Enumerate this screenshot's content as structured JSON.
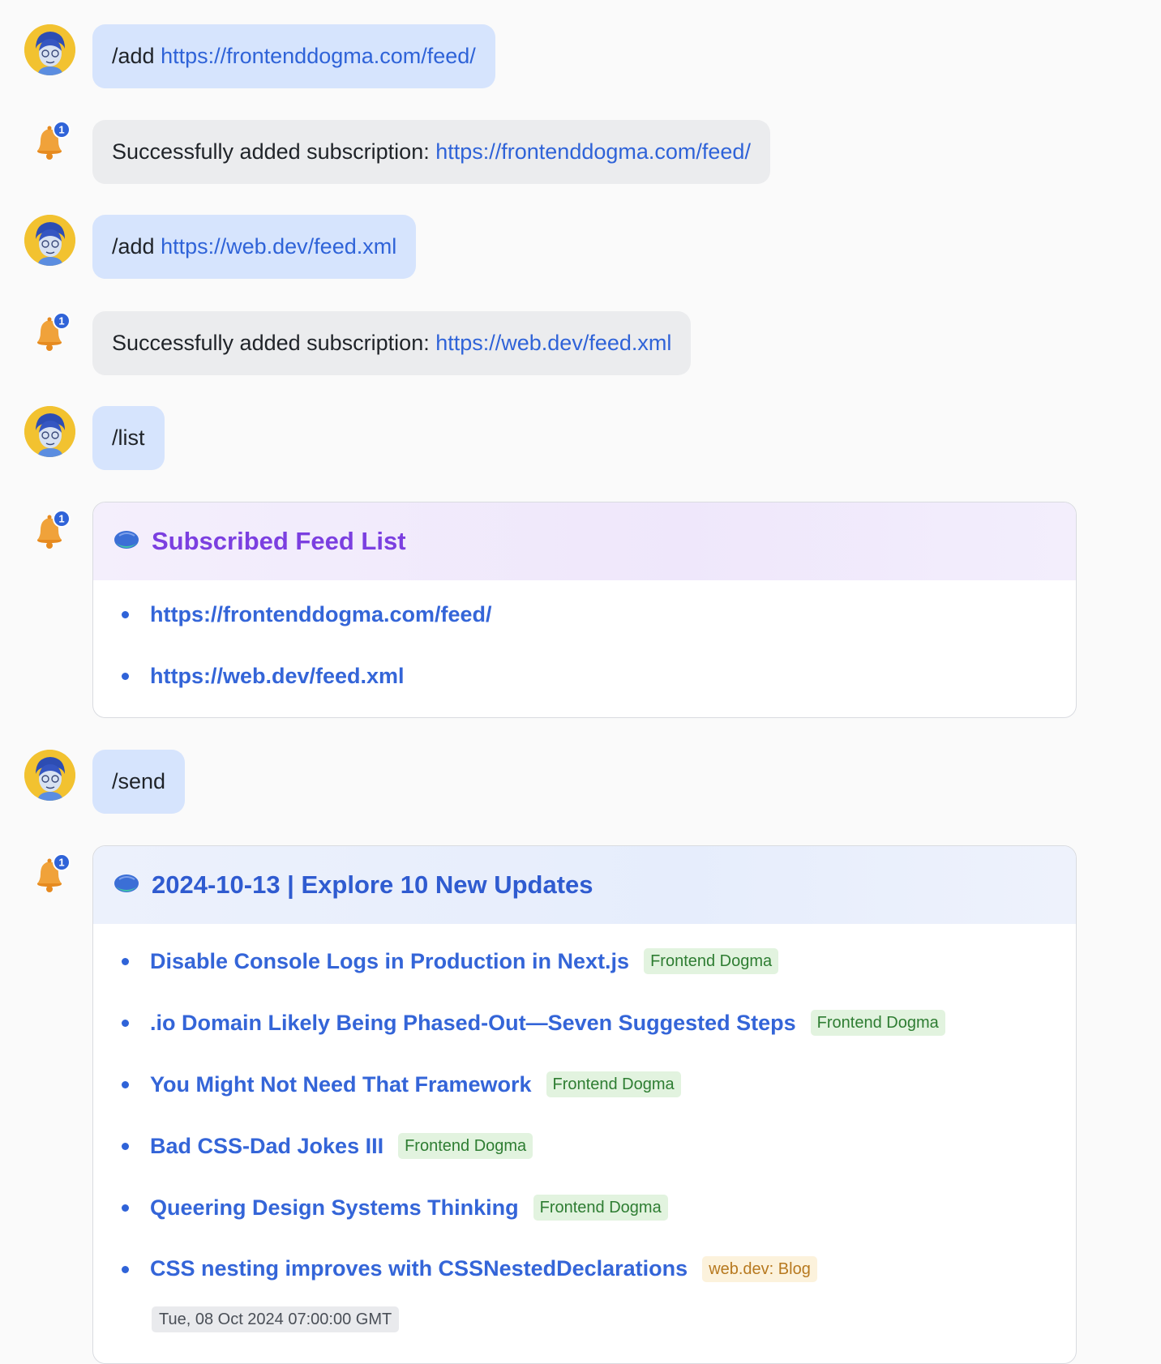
{
  "messages": [
    {
      "role": "user",
      "command": "/add",
      "link": "https://frontenddogma.com/feed/"
    },
    {
      "role": "bot",
      "text": "Successfully added subscription: ",
      "link": "https://frontenddogma.com/feed/"
    },
    {
      "role": "user",
      "command": "/add",
      "link": "https://web.dev/feed.xml"
    },
    {
      "role": "bot",
      "text": "Successfully added subscription: ",
      "link": "https://web.dev/feed.xml"
    },
    {
      "role": "user",
      "command": "/list"
    },
    {
      "role": "user",
      "command": "/send"
    }
  ],
  "feed_list_card": {
    "title": "Subscribed Feed List",
    "items": [
      "https://frontenddogma.com/feed/",
      "https://web.dev/feed.xml"
    ]
  },
  "updates_card": {
    "title": "2024-10-13 | Explore 10 New Updates",
    "items": [
      {
        "title": "Disable Console Logs in Production in Next.js",
        "source": "Frontend Dogma"
      },
      {
        "title": ".io Domain Likely Being Phased-Out—Seven Suggested Steps",
        "source": "Frontend Dogma"
      },
      {
        "title": "You Might Not Need That Framework",
        "source": "Frontend Dogma"
      },
      {
        "title": "Bad CSS-Dad Jokes III",
        "source": "Frontend Dogma"
      },
      {
        "title": "Queering Design Systems Thinking",
        "source": "Frontend Dogma"
      },
      {
        "title": "CSS nesting improves with CSSNestedDeclarations",
        "source": "web.dev: Blog",
        "date": "Tue, 08 Oct 2024 07:00:00 GMT"
      }
    ]
  },
  "bot_badge_count": "1",
  "colors": {
    "user_bubble": "#d6e4fd",
    "bot_bubble": "#ebecee",
    "link": "#2f63d8",
    "purple_title": "#7b3fe0",
    "blue_title": "#2f5bd0"
  },
  "icons": {
    "user_avatar": "avatar-icon",
    "bot_avatar": "bell-icon",
    "card_header": "planet-icon"
  }
}
